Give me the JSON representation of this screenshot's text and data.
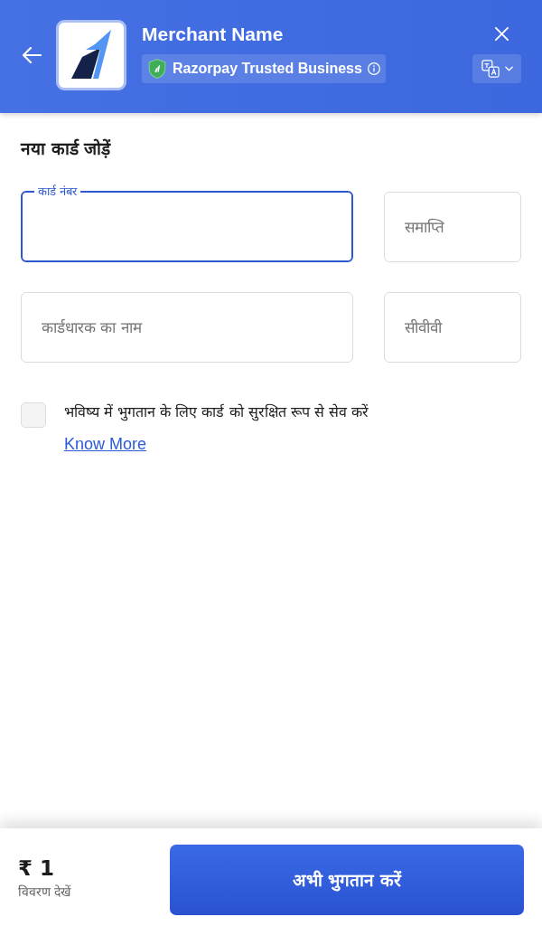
{
  "header": {
    "merchant_name": "Merchant Name",
    "trust_badge": "Razorpay Trusted Business"
  },
  "form": {
    "title": "नया कार्ड जोड़ें",
    "fields": [
      {
        "placeholder": "कार्ड नंबर",
        "focused": true
      },
      {
        "placeholder": "समाप्ति",
        "focused": false
      },
      {
        "placeholder": "कार्डधारक का नाम",
        "focused": false
      },
      {
        "placeholder": "सीवीवी",
        "focused": false
      }
    ],
    "save_card": {
      "label": "भविष्य में भुगतान के लिए कार्ड को सुरक्षित रूप से सेव करें",
      "checked": false,
      "link": "Know More"
    }
  },
  "footer": {
    "amount": "₹ 1",
    "details_link": "विवरण देखें",
    "pay_button": "अभी भुगतान करें"
  }
}
